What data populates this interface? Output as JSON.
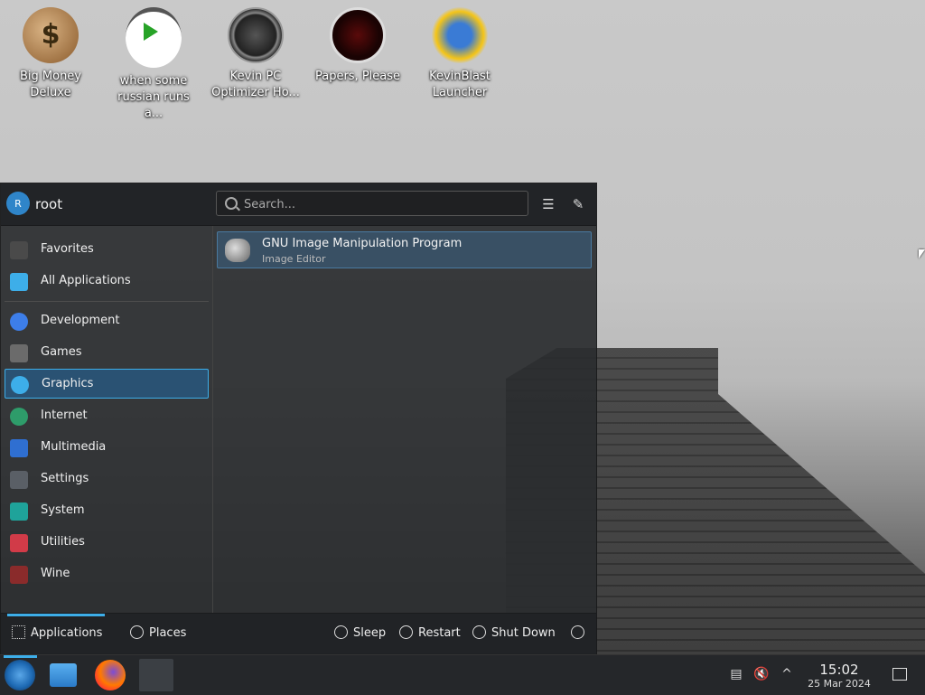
{
  "desktop": {
    "icons": [
      {
        "label_line1": "Big Money",
        "label_line2": "Deluxe",
        "icon": "money-bag-icon"
      },
      {
        "label_line1": "when some",
        "label_line2": "russian runs a...",
        "icon": "video-file-icon"
      },
      {
        "label_line1": "Kevin PC",
        "label_line2": "Optimizer Ho...",
        "icon": "speedometer-icon"
      },
      {
        "label_line1": "Papers, Please",
        "label_line2": "",
        "icon": "papers-please-icon"
      },
      {
        "label_line1": "KevinBlast",
        "label_line2": "Launcher",
        "icon": "kevinblast-icon"
      }
    ]
  },
  "launcher": {
    "user": {
      "initial": "R",
      "name": "root"
    },
    "search": {
      "placeholder": "Search..."
    },
    "categories": [
      {
        "label": "Favorites",
        "color": "#4a4a4a"
      },
      {
        "label": "All Applications",
        "color": "#3daee9"
      },
      {
        "label": "Development",
        "color": "#3d7ee9"
      },
      {
        "label": "Games",
        "color": "#6b6b6b"
      },
      {
        "label": "Graphics",
        "color": "#3daee9"
      },
      {
        "label": "Internet",
        "color": "#2e9c6a"
      },
      {
        "label": "Multimedia",
        "color": "#2f6fd1"
      },
      {
        "label": "Settings",
        "color": "#5a5f66"
      },
      {
        "label": "System",
        "color": "#1fa39a"
      },
      {
        "label": "Utilities",
        "color": "#d13b48"
      },
      {
        "label": "Wine",
        "color": "#8a2b2b"
      }
    ],
    "selected_category": "Graphics",
    "results": [
      {
        "title": "GNU Image Manipulation Program",
        "subtitle": "Image Editor"
      }
    ],
    "footer": {
      "applications": "Applications",
      "places": "Places",
      "sleep": "Sleep",
      "restart": "Restart",
      "shutdown": "Shut Down"
    }
  },
  "taskbar": {
    "clock": {
      "time": "15:02",
      "date": "25 Mar 2024"
    }
  },
  "colors": {
    "accent": "#3daee9",
    "selection": "#2a5273"
  }
}
